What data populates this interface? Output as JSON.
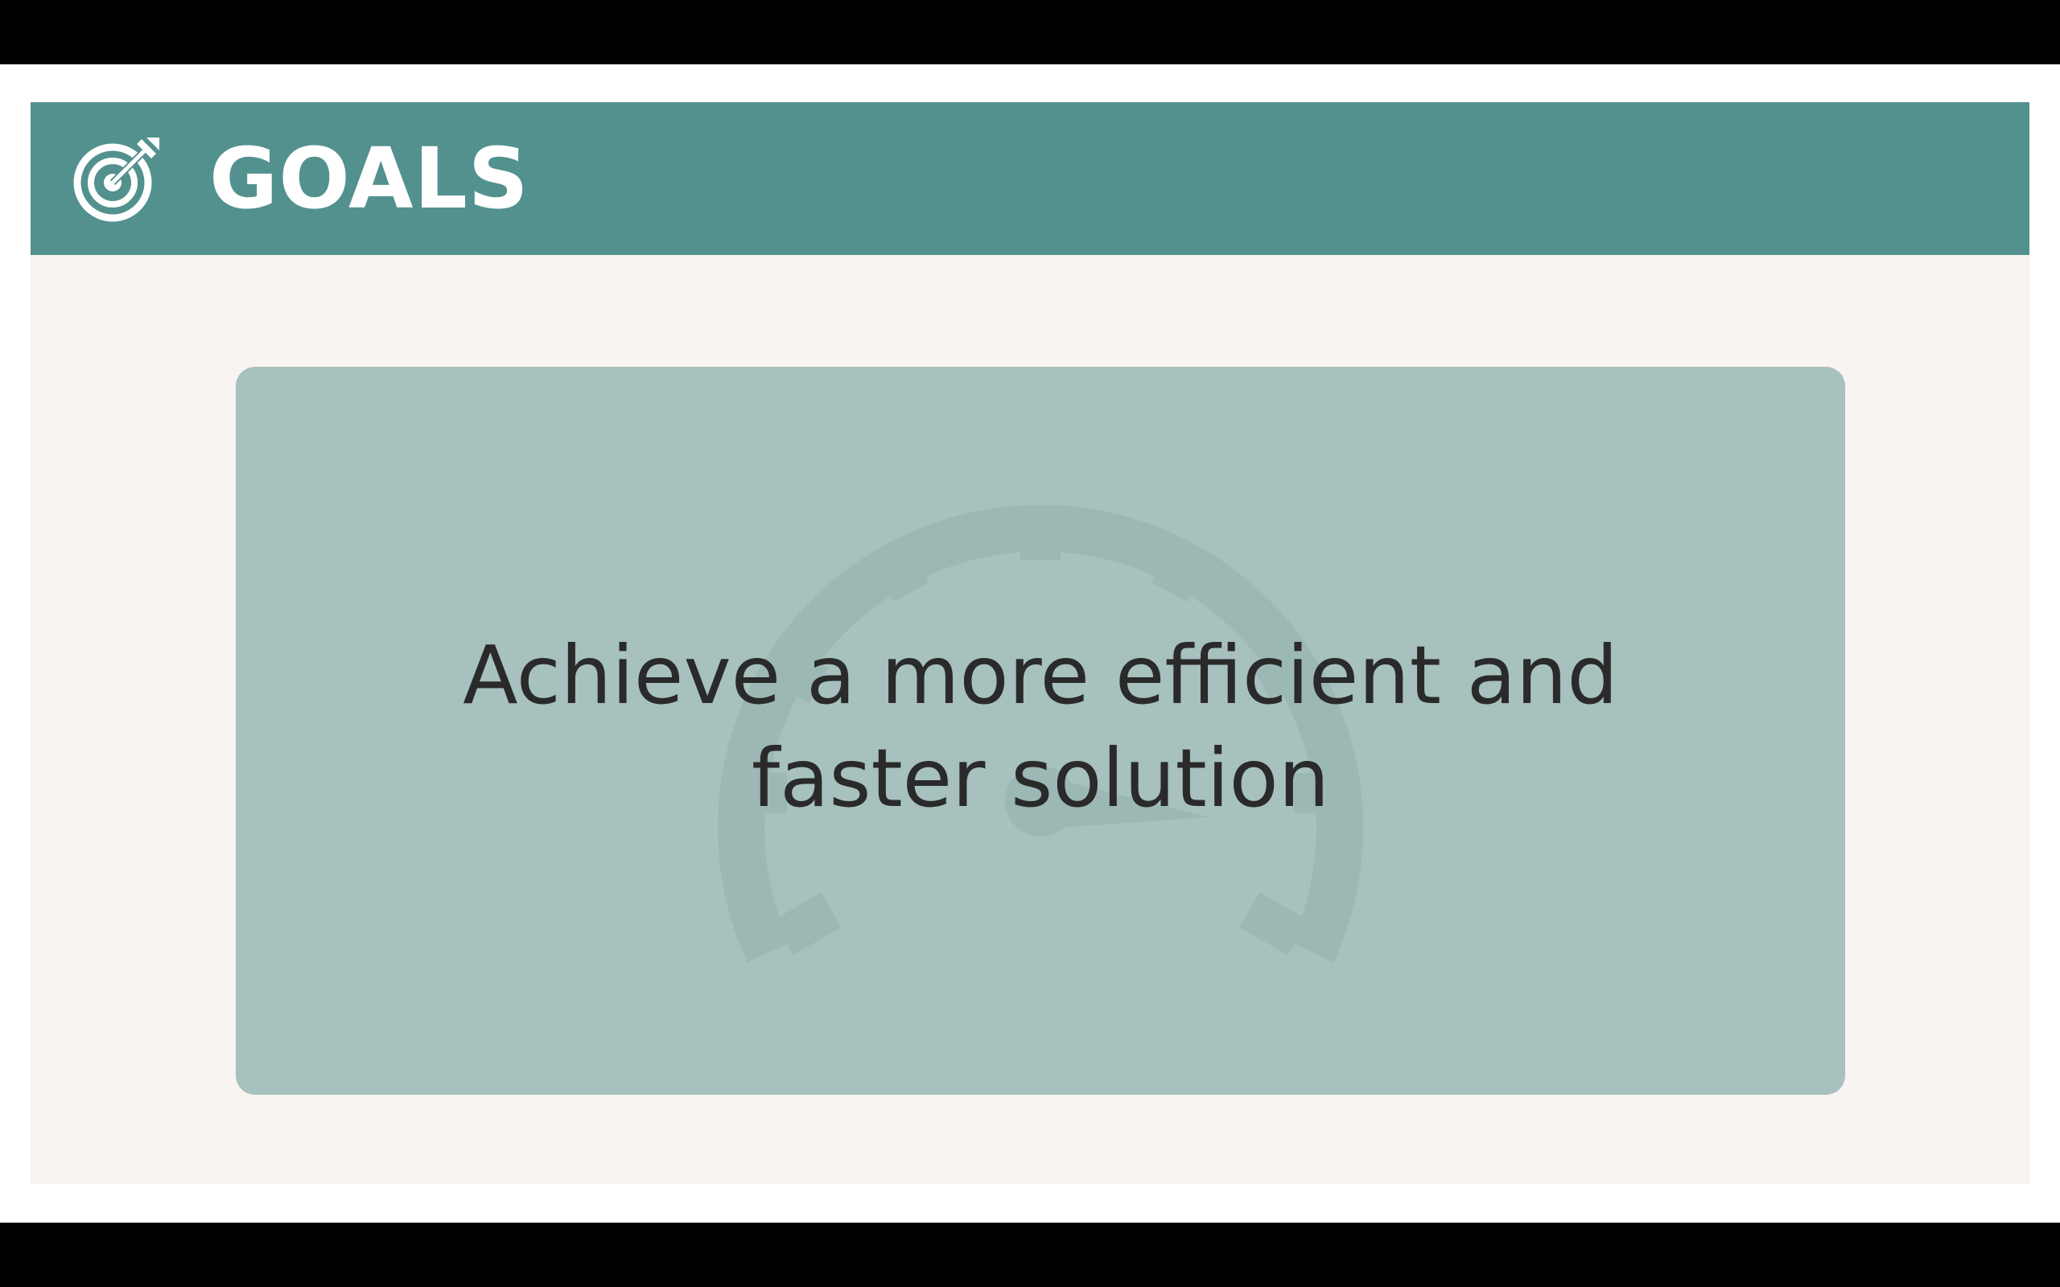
{
  "slide": {
    "header": {
      "title": "GOALS",
      "icon": "target-arrow-icon",
      "background_color": "#53918f",
      "text_color": "#ffffff"
    },
    "content": {
      "background_color": "#f8f4f1",
      "card": {
        "background_color": "#a6c1be",
        "watermark_icon": "speedometer-icon",
        "lines": [
          "Achieve a more efficient and",
          "faster solution"
        ],
        "text_color": "#2a2a2a"
      }
    }
  }
}
